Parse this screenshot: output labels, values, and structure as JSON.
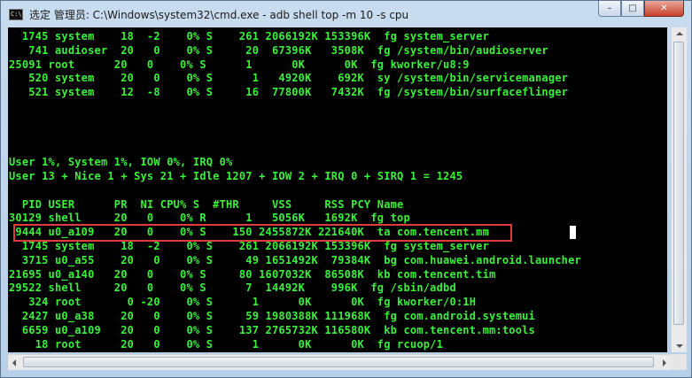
{
  "window": {
    "title": "选定 管理员: C:\\Windows\\system32\\cmd.exe - adb  shell top -m 10 -s cpu",
    "icon_label": "C:\\",
    "minimize": "–",
    "maximize": "□",
    "close": "✕"
  },
  "console": {
    "lines": [
      "  1745 system    18  -2    0% S    261 2066192K 153396K  fg system_server",
      "   741 audioser  20   0    0% S     20  67396K   3508K  fg /system/bin/audioserver",
      "25091 root      20   0    0% S      1      0K      0K  fg kworker/u8:9",
      "   520 system    20   0    0% S      1   4920K    692K  sy /system/bin/servicemanager",
      "   521 system    12  -8    0% S     16  77800K   7432K  fg /system/bin/surfaceflinger",
      "",
      "",
      "",
      "",
      "User 1%, System 1%, IOW 0%, IRQ 0%",
      "User 13 + Nice 1 + Sys 21 + Idle 1207 + IOW 2 + IRQ 0 + SIRQ 1 = 1245",
      "",
      "  PID USER      PR  NI CPU% S  #THR     VSS     RSS PCY Name",
      "30129 shell     20   0    0% R      1   5056K   1692K  fg top",
      " 9444 u0_a109   20   0    0% S    150 2455872K 221640K  ta com.tencent.mm",
      "  1745 system    18  -2    0% S    261 2066192K 153396K  fg system_server",
      "  3715 u0_a55    20   0    0% S     49 1651492K  79384K  bg com.huawei.android.launcher",
      "21695 u0_a140   20   0    0% S     80 1607032K  86508K  kb com.tencent.tim",
      "29522 shell     20   0    0% S      7  14492K    996K  fg /sbin/adbd",
      "   324 root       0 -20    0% S      1      0K      0K  fg kworker/0:1H",
      "  2427 u0_a38    20   0    0% S     59 1980388K 111968K  fg com.android.systemui",
      "  6659 u0_a109   20   0    0% S    137 2765732K 116580K  kb com.tencent.mm:tools",
      "    18 root      20   0    0% S      1      0K      0K  fg rcuop/1"
    ],
    "highlighted_line_index": 14,
    "text_color": "#3cf03c",
    "highlight_color": "#e03b3b"
  }
}
